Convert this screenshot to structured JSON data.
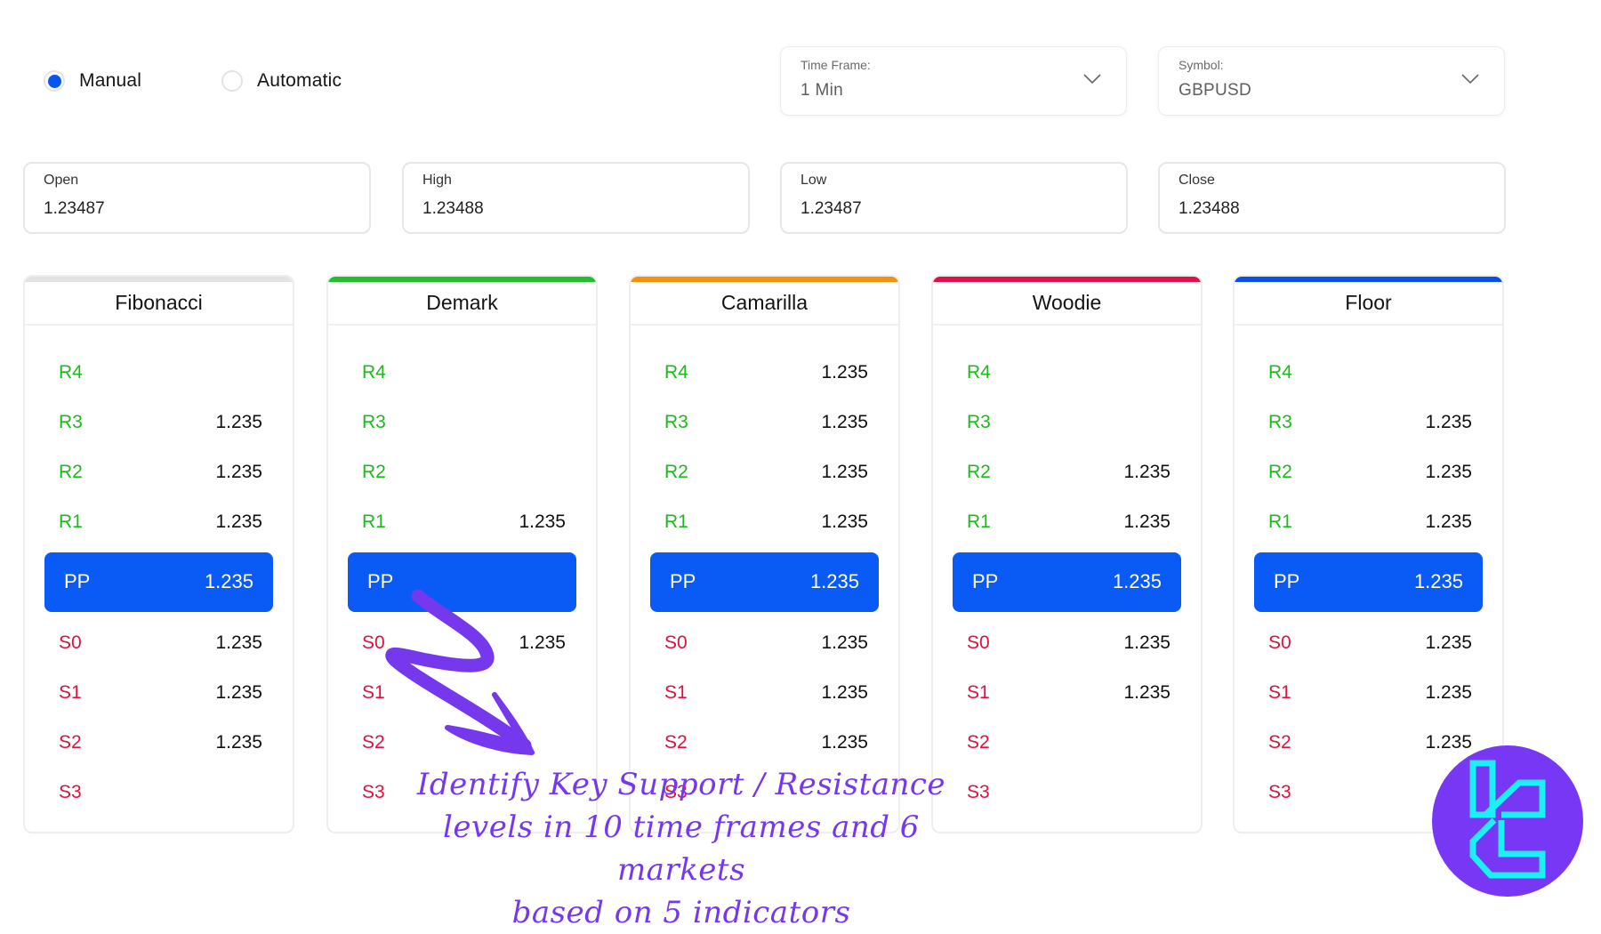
{
  "mode": {
    "options": [
      {
        "label": "Manual",
        "selected": true
      },
      {
        "label": "Automatic",
        "selected": false
      }
    ]
  },
  "time_frame": {
    "caption": "Time Frame:",
    "value": "1 Min",
    "icon": "chevron-down-icon"
  },
  "symbol": {
    "caption": "Symbol:",
    "value": "GBPUSD",
    "icon": "chevron-down-icon"
  },
  "ohlc": {
    "open": {
      "label": "Open",
      "value": "1.23487"
    },
    "high": {
      "label": "High",
      "value": "1.23488"
    },
    "low": {
      "label": "Low",
      "value": "1.23487"
    },
    "close": {
      "label": "Close",
      "value": "1.23488"
    }
  },
  "colors": {
    "resistance": "#1fb81f",
    "support": "#e0103f",
    "pivot_bg": "#0a5af5",
    "annotation": "#7638ec",
    "logo_bg": "#7836f5",
    "logo_fg": "#1af0f5"
  },
  "indicators": [
    {
      "name": "Fibonacci",
      "accent": "#e3e3e6",
      "R4": "",
      "R3": "1.235",
      "R2": "1.235",
      "R1": "1.235",
      "PP": "1.235",
      "S0": "1.235",
      "S1": "1.235",
      "S2": "1.235",
      "S3": ""
    },
    {
      "name": "Demark",
      "accent": "#22c02a",
      "R4": "",
      "R3": "",
      "R2": "",
      "R1": "1.235",
      "PP": "",
      "S0": "1.235",
      "S1": "",
      "S2": "",
      "S3": ""
    },
    {
      "name": "Camarilla",
      "accent": "#f5900a",
      "R4": "1.235",
      "R3": "1.235",
      "R2": "1.235",
      "R1": "1.235",
      "PP": "1.235",
      "S0": "1.235",
      "S1": "1.235",
      "S2": "1.235",
      "S3": ""
    },
    {
      "name": "Woodie",
      "accent": "#e0104a",
      "R4": "",
      "R3": "",
      "R2": "1.235",
      "R1": "1.235",
      "PP": "1.235",
      "S0": "1.235",
      "S1": "1.235",
      "S2": "",
      "S3": ""
    },
    {
      "name": "Floor",
      "accent": "#0a50e6",
      "R4": "",
      "R3": "1.235",
      "R2": "1.235",
      "R1": "1.235",
      "PP": "1.235",
      "S0": "1.235",
      "S1": "1.235",
      "S2": "1.235",
      "S3": ""
    }
  ],
  "level_labels": {
    "R4": "R4",
    "R3": "R3",
    "R2": "R2",
    "R1": "R1",
    "PP": "PP",
    "S0": "S0",
    "S1": "S1",
    "S2": "S2",
    "S3": "S3"
  },
  "annotation": {
    "lines": [
      "Identify Key Support / Resistance",
      "levels in 10 time frames and 6 markets",
      "based on 5 indicators"
    ],
    "icon": "curved-arrow-icon"
  },
  "logo": {
    "icon": "brand-logo-icon"
  }
}
